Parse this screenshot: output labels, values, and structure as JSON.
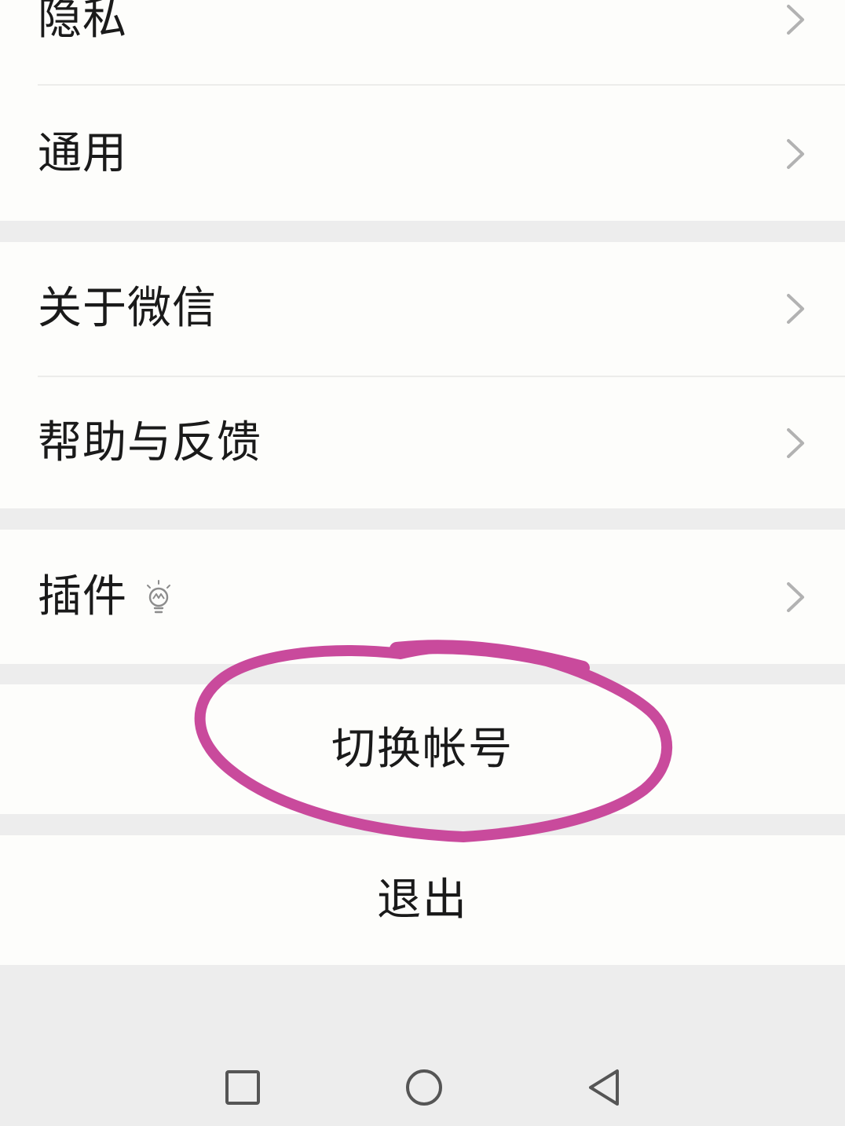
{
  "settings": {
    "group1": {
      "privacy_label": "隐私",
      "general_label": "通用"
    },
    "group2": {
      "about_label": "关于微信",
      "help_label": "帮助与反馈"
    },
    "group3": {
      "plugins_label": "插件"
    },
    "switch_account_label": "切换帐号",
    "logout_label": "退出"
  },
  "colors": {
    "annotation_stroke": "#c94a9c",
    "chevron": "#b2b2b2",
    "background": "#ededed",
    "cell": "#fdfdfb"
  },
  "icons": {
    "row_chevron": "chevron-right-icon",
    "plugin_badge": "lightbulb-icon",
    "nav_recent": "square-icon",
    "nav_home": "circle-icon",
    "nav_back": "triangle-back-icon"
  }
}
